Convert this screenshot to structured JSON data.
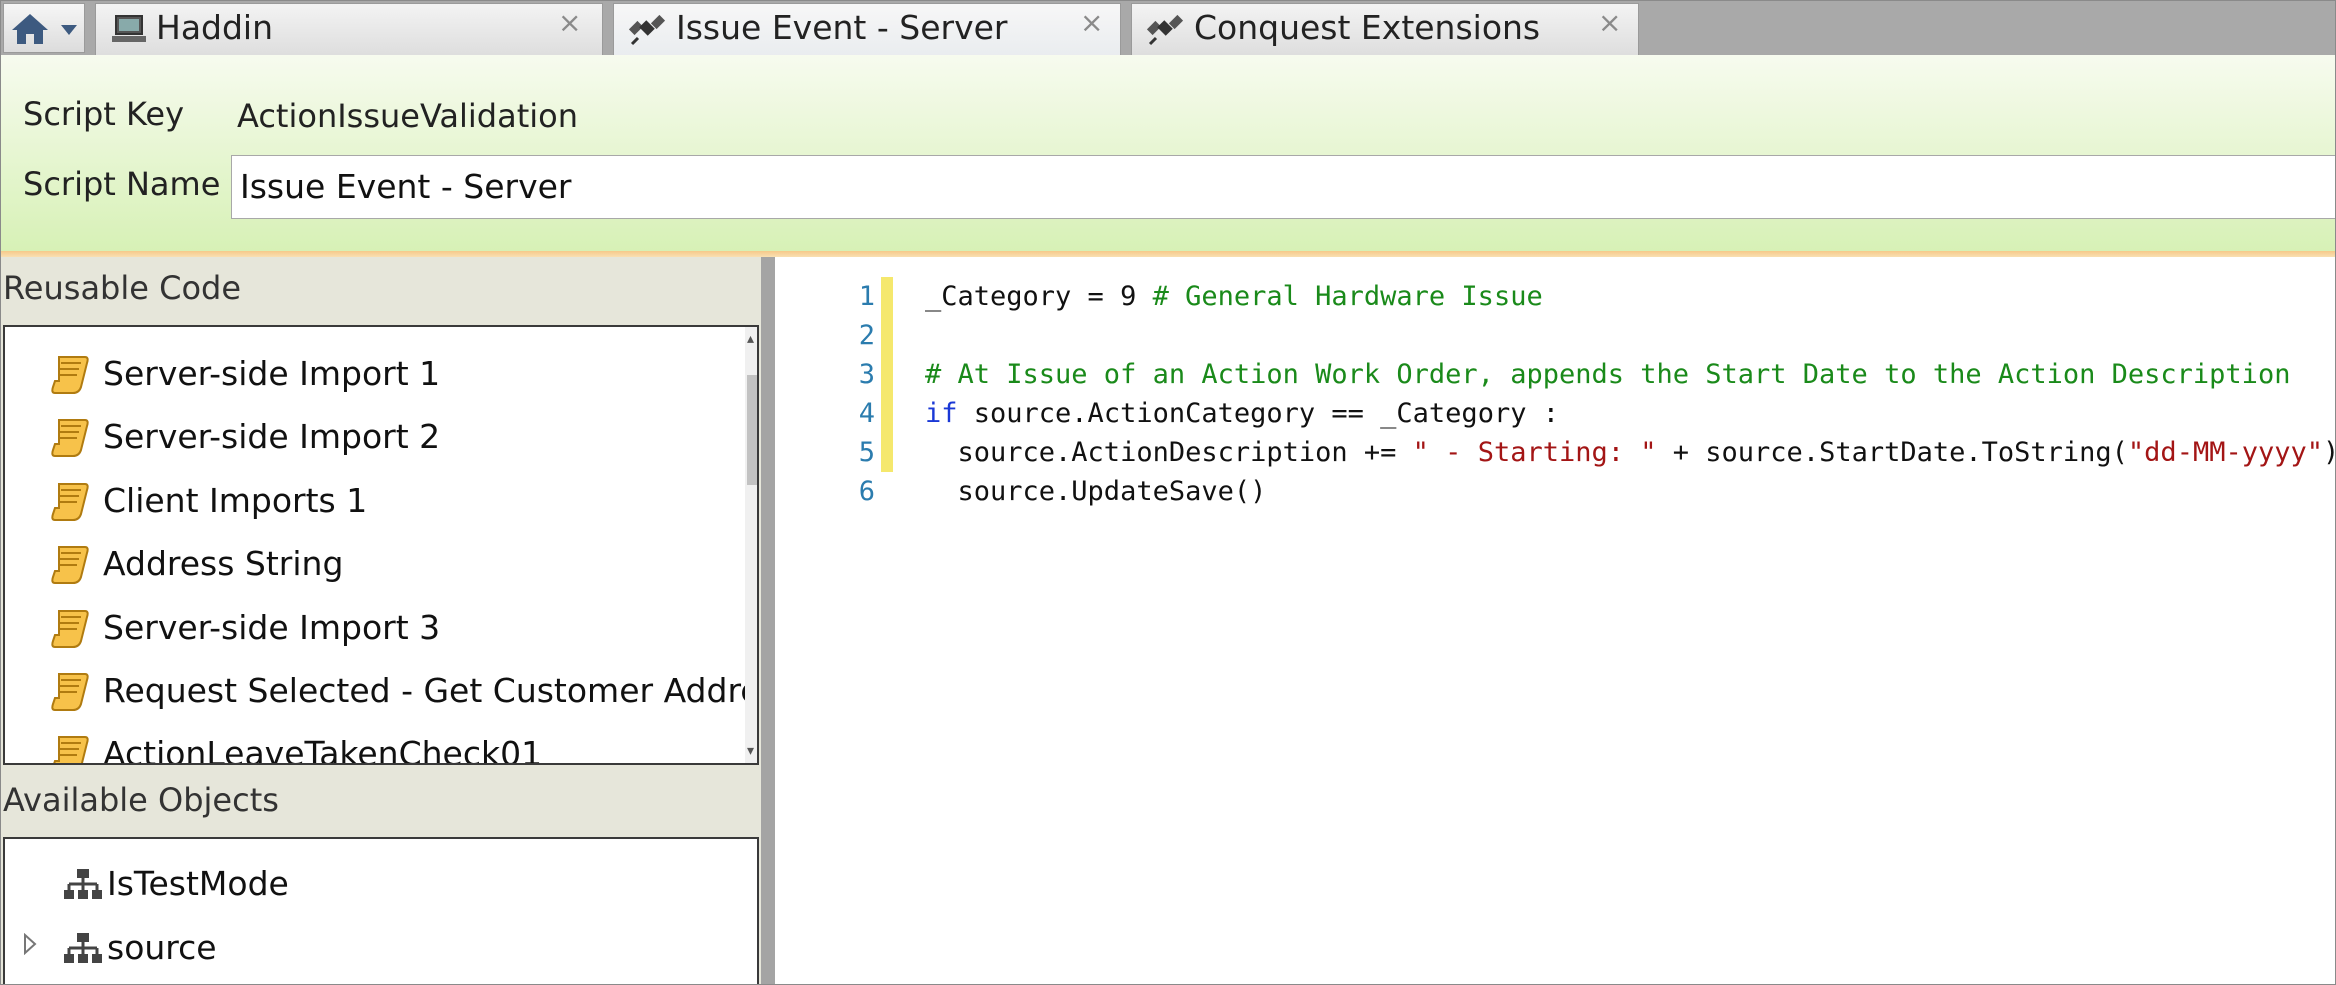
{
  "tabs": [
    {
      "label": "Haddin",
      "active": false
    },
    {
      "label": "Issue Event - Server",
      "active": true
    },
    {
      "label": "Conquest Extensions",
      "active": false
    }
  ],
  "tab_close_glyph": "×",
  "header": {
    "script_key_label": "Script Key",
    "script_key_value": "ActionIssueValidation",
    "script_name_label": "Script Name",
    "script_name_value": "Issue Event - Server"
  },
  "reusable_code": {
    "title": "Reusable Code",
    "items": [
      "Server-side Import 1",
      "Server-side Import 2",
      "Client Imports 1",
      "Address String",
      "Server-side Import 3",
      "Request Selected - Get Customer Address",
      "ActionLeaveTakenCheck01"
    ]
  },
  "available_objects": {
    "title": "Available Objects",
    "items": [
      {
        "label": "IsTestMode",
        "expandable": false
      },
      {
        "label": "source",
        "expandable": true
      }
    ]
  },
  "editor": {
    "line_numbers": [
      "1",
      "2",
      "3",
      "4",
      "5",
      "6"
    ],
    "lines": [
      [
        {
          "t": "_Category = 9 ",
          "c": ""
        },
        {
          "t": "# General Hardware Issue",
          "c": "c-com"
        }
      ],
      [],
      [
        {
          "t": "# At Issue of an Action Work Order, appends the Start Date to the Action Description",
          "c": "c-com"
        }
      ],
      [
        {
          "t": "if",
          "c": "c-kw"
        },
        {
          "t": " source.ActionCategory == _Category :",
          "c": ""
        }
      ],
      [
        {
          "t": "  source.ActionDescription += ",
          "c": ""
        },
        {
          "t": "\" - Starting: \"",
          "c": "c-str"
        },
        {
          "t": " + source.StartDate.ToString(",
          "c": ""
        },
        {
          "t": "\"dd-MM-yyyy\"",
          "c": "c-str"
        },
        {
          "t": ")",
          "c": ""
        }
      ],
      [
        {
          "t": "  source.UpdateSave()",
          "c": ""
        }
      ]
    ],
    "modified_lines": [
      1,
      2,
      3,
      4,
      5
    ]
  },
  "colors": {
    "comment": "#1a8a1a",
    "keyword": "#1a38d6",
    "string": "#a31515",
    "line_number": "#2b7cae",
    "change_marker": "#f5e86d"
  }
}
